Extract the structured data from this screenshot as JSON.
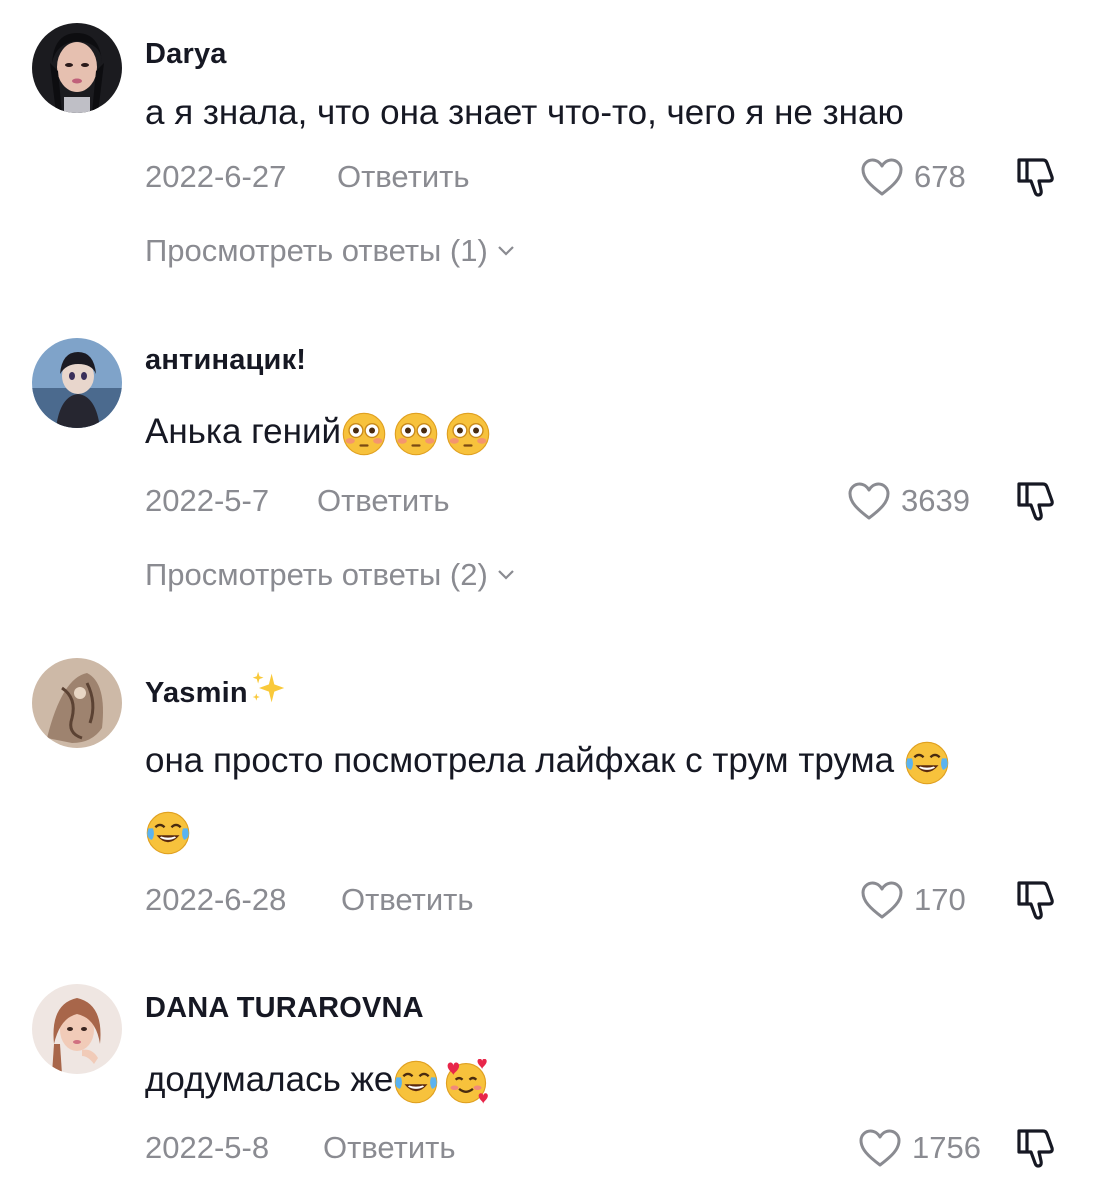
{
  "comments": [
    {
      "username": "Darya",
      "text": "а я знала, что она знает что-то, чего я не знаю",
      "date": "2022-6-27",
      "reply_label": "Ответить",
      "likes": "678",
      "view_replies": "Просмотреть ответы (1)"
    },
    {
      "username": "антинацик!",
      "text": "Анька гений",
      "text_emoji": [
        "flushed-face",
        "flushed-face",
        "flushed-face"
      ],
      "date": "2022-5-7",
      "reply_label": "Ответить",
      "likes": "3639",
      "view_replies": "Просмотреть ответы (2)"
    },
    {
      "username": "Yasmin",
      "username_emoji": "sparkles",
      "text": "она просто посмотрела лайфхак с трум трума",
      "text_emoji": [
        "tears-of-joy-face",
        "tears-of-joy-face"
      ],
      "date": "2022-6-28",
      "reply_label": "Ответить",
      "likes": "170"
    },
    {
      "username": "DANA TURAROVNA",
      "text": "додумалась же",
      "text_emoji": [
        "tears-of-joy-face",
        "smiling-face-with-hearts"
      ],
      "date": "2022-5-8",
      "reply_label": "Ответить",
      "likes": "1756"
    }
  ],
  "colors": {
    "text": "#161823",
    "secondary": "#8a8b91",
    "background": "#ffffff"
  }
}
